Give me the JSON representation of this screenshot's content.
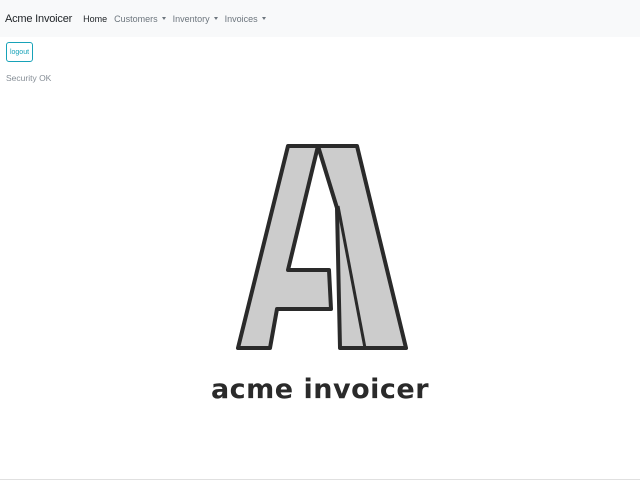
{
  "navbar": {
    "brand": "Acme Invoicer",
    "items": [
      {
        "label": "Home",
        "active": true,
        "dropdown": false
      },
      {
        "label": "Customers",
        "active": false,
        "dropdown": true
      },
      {
        "label": "Inventory",
        "active": false,
        "dropdown": true
      },
      {
        "label": "Invoices",
        "active": false,
        "dropdown": true
      }
    ]
  },
  "logout": {
    "label": "logout"
  },
  "status": {
    "text": "Security OK"
  },
  "logo": {
    "text": "acme invoicer"
  },
  "colors": {
    "navbar_bg": "#f8f9fa",
    "accent": "#17a2b8",
    "logo_fill": "#cccccc",
    "logo_stroke": "#2a2a2a"
  }
}
